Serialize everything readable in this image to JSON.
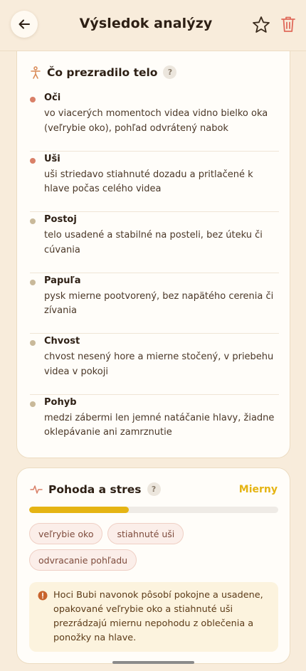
{
  "header": {
    "title": "Výsledok analýzy",
    "back_icon": "arrow-left-icon",
    "favorite_icon": "star-icon",
    "delete_icon": "trash-icon"
  },
  "body_section": {
    "title": "Čo prezradilo telo",
    "help_label": "?",
    "icon": "body-figure-icon",
    "items": [
      {
        "name": "Oči",
        "desc": "vo viacerých momentoch videa vidno bielko oka (veľrybie oko), pohľad odvrátený nabok",
        "dot_color": "#d98068"
      },
      {
        "name": "Uši",
        "desc": "uši striedavo stiahnuté dozadu a pritlačené k hlave počas celého videa",
        "dot_color": "#d98068"
      },
      {
        "name": "Postoj",
        "desc": "telo usadené a stabilné na posteli, bez úteku či cúvania",
        "dot_color": "#c9b99a"
      },
      {
        "name": "Papuľa",
        "desc": "pysk mierne pootvorený, bez napätého cerenia či zívania",
        "dot_color": "#c9b99a"
      },
      {
        "name": "Chvost",
        "desc": "chvost nesený hore a mierne stočený, v priebehu videa v pokoji",
        "dot_color": "#c9b99a"
      },
      {
        "name": "Pohyb",
        "desc": "medzi zábermi len jemné natáčanie hlavy, žiadne oklepávanie ani zamrznutie",
        "dot_color": "#c9b99a"
      }
    ]
  },
  "stress_section": {
    "title": "Pohoda a stres",
    "help_label": "?",
    "icon": "pulse-icon",
    "level": "Mierny",
    "level_fraction": 0.4,
    "tags": [
      "veľrybie oko",
      "stiahnuté uši",
      "odvracanie pohľadu"
    ],
    "note_icon": "info-icon",
    "note": "Hoci Bubi navonok pôsobí pokojne a usadene, opakované veľrybie oko a stiahnuté uši prezrádzajú miernu nepohodu z oblečenia a ponožky na hlave."
  },
  "colors": {
    "background": "#f8ecdb",
    "accent_yellow": "#e5b413",
    "delete_red": "#e0695a",
    "dot_alert": "#d98068",
    "dot_neutral": "#c9b99a"
  }
}
